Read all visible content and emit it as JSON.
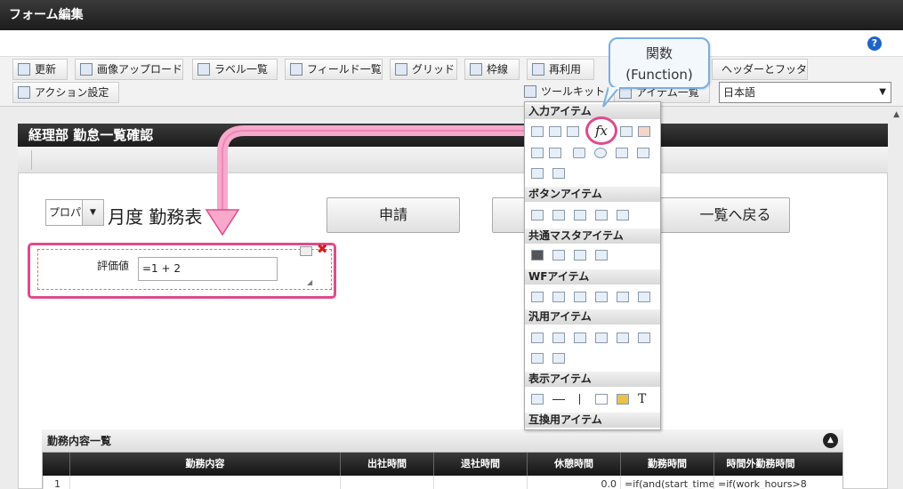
{
  "window": {
    "title": "フォーム編集",
    "help_icon": "?"
  },
  "toolbar": {
    "buttons": [
      {
        "label": "更新",
        "icon": "refresh-icon"
      },
      {
        "label": "画像アップロード",
        "icon": "image-upload-icon"
      },
      {
        "label": "ラベル一覧",
        "icon": "label-list-icon"
      },
      {
        "label": "フィールド一覧",
        "icon": "field-list-icon"
      },
      {
        "label": "グリッド",
        "icon": "grid-icon"
      },
      {
        "label": "枠線",
        "icon": "border-icon"
      },
      {
        "label": "再利用",
        "icon": "reuse-icon"
      },
      {
        "label": "ヘッダーとフッター",
        "icon": "header-footer-icon"
      },
      {
        "label": "アクション設定",
        "icon": "action-settings-icon"
      },
      {
        "label": "ツールキット",
        "icon": "toolkit-icon"
      },
      {
        "label": "アイテム一覧",
        "icon": "item-list-icon"
      }
    ],
    "language_select": {
      "value": "日本語"
    }
  },
  "callout": {
    "line1": "関数",
    "line2": "(Function)"
  },
  "form": {
    "title": "経理部 勤怠一覧確認",
    "year_select": "プロパ",
    "month_label": "月度 勤務表",
    "buttons": [
      "申請",
      "",
      "一覧へ戻る"
    ],
    "field": {
      "label": "評価値",
      "value": "=1 + 2"
    }
  },
  "toolkit": {
    "sections": [
      {
        "label": "入力アイテム"
      },
      {
        "label": "ボタンアイテム"
      },
      {
        "label": "共通マスタアイテム"
      },
      {
        "label": "WFアイテム"
      },
      {
        "label": "汎用アイテム"
      },
      {
        "label": "表示アイテム"
      },
      {
        "label": "互換用アイテム"
      }
    ],
    "function_icon": "fx"
  },
  "table": {
    "title": "勤務内容一覧",
    "toggle": "▲",
    "headers": [
      "勤務内容",
      "出社時間",
      "退社時間",
      "休憩時間",
      "勤務時間",
      "時間外勤務時間"
    ],
    "rows": [
      {
        "no": "1",
        "cells": [
          "",
          "",
          "",
          "0.0",
          "=if(and(start_time>",
          "=if(work_hours>8"
        ]
      }
    ]
  },
  "colors": {
    "accent": "#e04a8c",
    "callout_border": "#7aaee0",
    "titlebar": "#2a2a2a"
  }
}
